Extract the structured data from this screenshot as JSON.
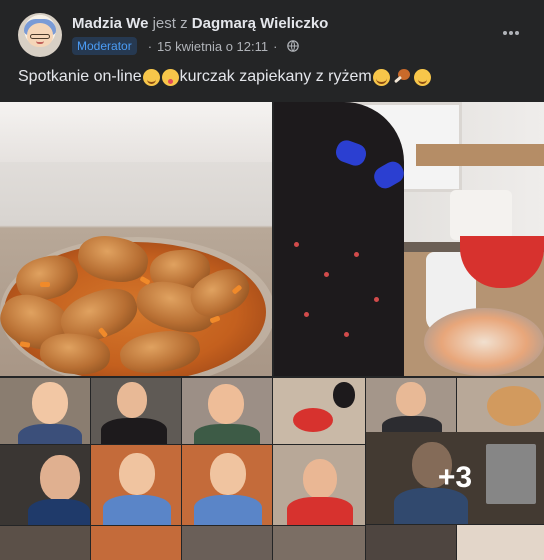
{
  "post": {
    "author": "Madzia We",
    "with_word": "jest z",
    "tagged": "Dagmarą Wieliczko",
    "role_badge": "Moderator",
    "date": "15 kwietnia o 12:11",
    "caption_part1": "Spotkanie on-line",
    "caption_part2": "kurczak zapiekany z ryżem"
  },
  "media": {
    "extra_count": "+3"
  },
  "icons": {
    "privacy": "globe-icon",
    "more": "more-options-icon"
  },
  "colors": {
    "background": "#242526",
    "badge_bg": "#263951",
    "badge_text": "#4b9cf5"
  }
}
